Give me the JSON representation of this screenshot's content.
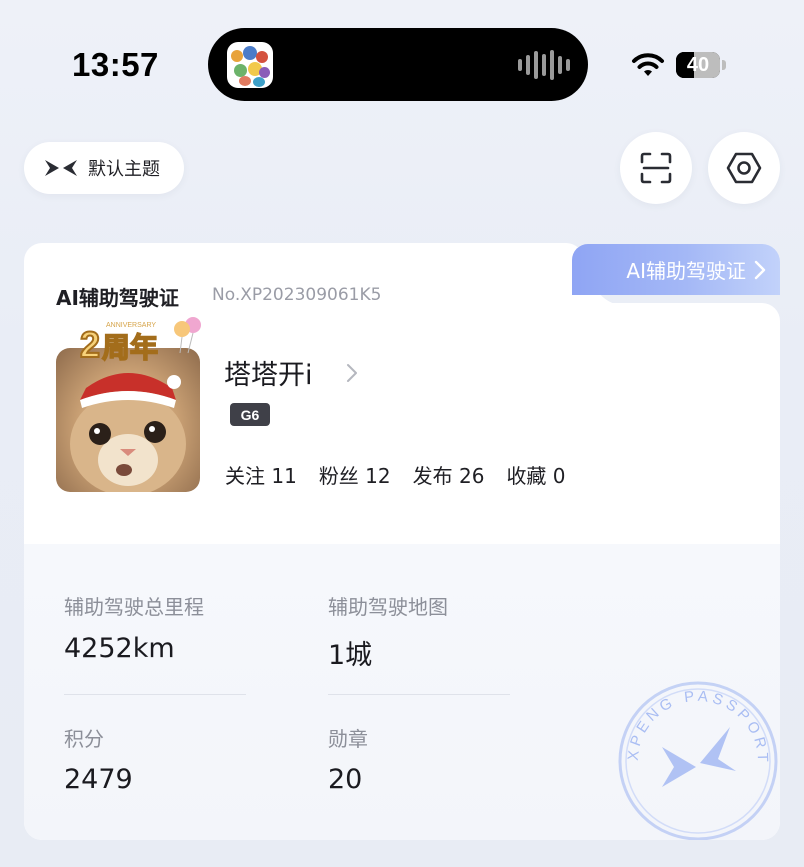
{
  "status_bar": {
    "time": "13:57",
    "battery": "40",
    "battery_level_percent": 40,
    "icons": [
      "wifi-icon",
      "battery-icon"
    ]
  },
  "top_bar": {
    "theme_label": "默认主题",
    "icons": [
      "xpeng-logo-icon",
      "scan-icon",
      "settings-icon"
    ]
  },
  "card": {
    "title": "AI辅助驾驶证",
    "number": "No.XP202309061K5",
    "badge_label": "AI辅助驾驶证",
    "profile": {
      "username": "塔塔开i",
      "model": "G6",
      "counters": [
        {
          "label": "关注",
          "value": "11"
        },
        {
          "label": "粉丝",
          "value": "12"
        },
        {
          "label": "发布",
          "value": "26"
        },
        {
          "label": "收藏",
          "value": "0"
        }
      ],
      "avatar_frame_text": "2周年",
      "avatar_frame_small": "ANNIVERSARY"
    },
    "stats": [
      {
        "label": "辅助驾驶总里程",
        "value": "4252km"
      },
      {
        "label": "辅助驾驶地图",
        "value": "1城"
      },
      {
        "label": "积分",
        "value": "2479"
      },
      {
        "label": "勋章",
        "value": "20"
      }
    ],
    "stamp_text": "XPENG PASSPORT"
  },
  "colors": {
    "badge_gradient_start": "#8fa5f4",
    "badge_gradient_end": "#c2d2fa",
    "stamp": "#a9bdf3"
  }
}
